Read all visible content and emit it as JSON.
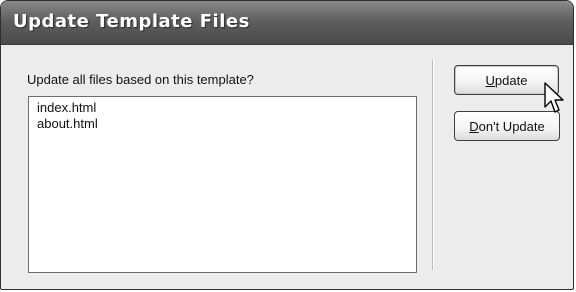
{
  "dialog": {
    "title": "Update Template Files",
    "prompt": "Update all files based on this template?",
    "files": [
      "index.html",
      "about.html"
    ],
    "buttons": {
      "update_label": "Update",
      "dont_update_label": "Don't Update"
    }
  },
  "icons": {
    "cursor": "arrow-pointer-icon"
  }
}
